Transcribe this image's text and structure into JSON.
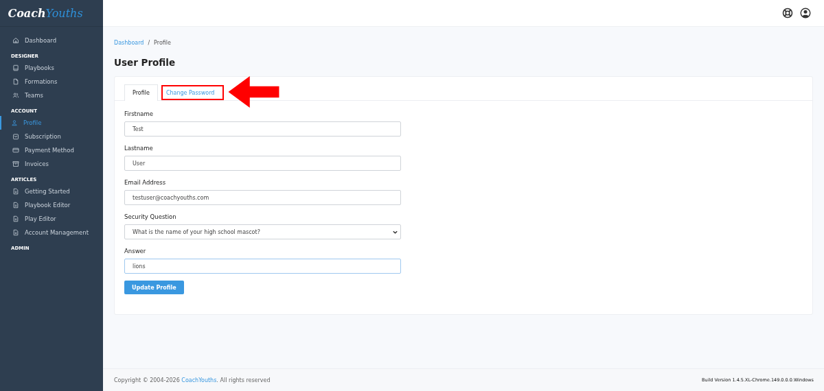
{
  "logo": {
    "first": "Coach",
    "second": "Youths"
  },
  "sidebar": {
    "items": [
      {
        "label": "Dashboard",
        "kind": "home",
        "selected": false
      },
      {
        "heading": "DESIGNER",
        "items": [
          {
            "label": "Playbooks",
            "kind": "book",
            "selected": false
          },
          {
            "label": "Formations",
            "kind": "file",
            "selected": false
          },
          {
            "label": "Teams",
            "kind": "users",
            "selected": false
          }
        ]
      },
      {
        "heading": "ACCOUNT",
        "items": [
          {
            "label": "Profile",
            "kind": "user",
            "selected": true
          },
          {
            "label": "Subscription",
            "kind": "bag",
            "selected": false
          },
          {
            "label": "Payment Method",
            "kind": "card",
            "selected": false
          },
          {
            "label": "Invoices",
            "kind": "archive",
            "selected": false
          }
        ]
      },
      {
        "heading": "ARTICLES",
        "items": [
          {
            "label": "Getting Started",
            "kind": "doc",
            "selected": false
          },
          {
            "label": "Playbook Editor",
            "kind": "doc",
            "selected": false
          },
          {
            "label": "Play Editor",
            "kind": "doc",
            "selected": false
          },
          {
            "label": "Account Management",
            "kind": "doc",
            "selected": false
          }
        ]
      },
      {
        "heading": "ADMIN"
      }
    ]
  },
  "breadcrumb": {
    "separator": "/",
    "items": [
      "Dashboard",
      "Profile"
    ]
  },
  "title": "User Profile",
  "tabs": [
    {
      "label": "Profile",
      "selected": true,
      "highlighted": false
    },
    {
      "label": "Change Password",
      "selected": false,
      "highlighted": true
    }
  ],
  "form": {
    "fields": [
      {
        "label": "Firstname",
        "kind": "text",
        "value": "Test",
        "focused": false
      },
      {
        "label": "Lastname",
        "kind": "text",
        "value": "User",
        "focused": false
      },
      {
        "label": "Email Address",
        "kind": "text",
        "value": "testuser@coachyouths.com",
        "focused": false
      },
      {
        "label": "Security Question",
        "kind": "select",
        "value": "What is the name of your high school mascot?",
        "focused": false
      },
      {
        "label": "Answer",
        "kind": "text",
        "value": "lions",
        "focused": true
      }
    ],
    "button": "Update Profile"
  },
  "footer": {
    "copyright": "Copyright © 2004-2026",
    "link": "CoachYouths",
    "rest": ". All rights reserved",
    "build": "Build Version 1.4.5.XL-Chrome.149.0.0.0.Windows"
  }
}
